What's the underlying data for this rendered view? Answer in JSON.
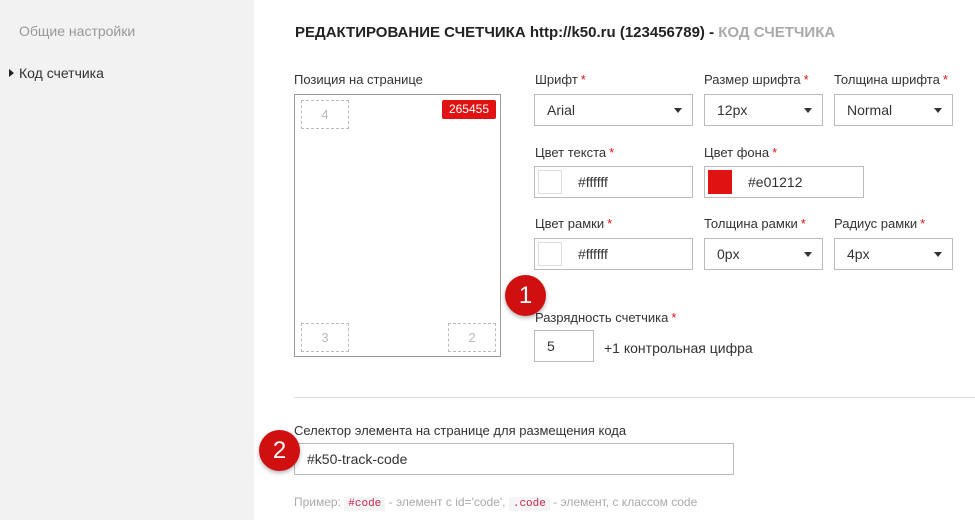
{
  "sidebar": {
    "items": [
      {
        "label": "Общие настройки"
      },
      {
        "label": "Код счетчика"
      }
    ]
  },
  "header": {
    "title": "РЕДАКТИРОВАНИЕ СЧЕТЧИКА http://k50.ru (123456789)",
    "separator": " - ",
    "subtitle": "КОД СЧЕТЧИКА"
  },
  "position": {
    "label": "Позиция на странице",
    "slots": [
      "4",
      "3",
      "2"
    ],
    "counter_value": "265455"
  },
  "font": {
    "label": "Шрифт",
    "value": "Arial"
  },
  "font_size": {
    "label": "Размер шрифта",
    "value": "12px"
  },
  "font_weight": {
    "label": "Толщина шрифта",
    "value": "Normal"
  },
  "text_color": {
    "label": "Цвет текста",
    "value": "#ffffff",
    "swatch": "#ffffff"
  },
  "bg_color": {
    "label": "Цвет фона",
    "value": "#e01212",
    "swatch": "#e01212"
  },
  "border_color": {
    "label": "Цвет рамки",
    "value": "#ffffff",
    "swatch": "#ffffff"
  },
  "border_width": {
    "label": "Толщина рамки",
    "value": "0px"
  },
  "border_radius": {
    "label": "Радиус рамки",
    "value": "4px"
  },
  "digits": {
    "label": "Разрядность счетчика",
    "value": "5",
    "note": "+1 контрольная цифра"
  },
  "selector": {
    "label": "Селектор элемента на странице для размещения кода",
    "value": "#k50-track-code"
  },
  "hint": {
    "prefix": "Пример:",
    "code1": "#code",
    "text1": "- элемент с id='code',",
    "code2": ".code",
    "text2": "- элемент, с классом code"
  },
  "markers": [
    "1",
    "2"
  ],
  "required_mark": "*",
  "colors": {
    "accent": "#e01212",
    "marker": "#d01010",
    "sidebar_bg": "#f2f2f2"
  }
}
